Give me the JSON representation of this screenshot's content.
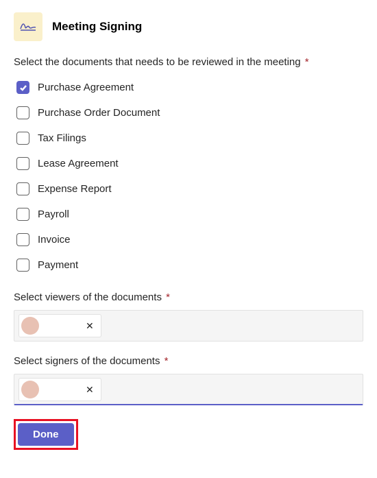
{
  "header": {
    "title": "Meeting Signing"
  },
  "fields": {
    "documents": {
      "label": "Select the documents that needs to be reviewed in the meeting",
      "required_marker": "*",
      "items": [
        {
          "label": "Purchase Agreement",
          "checked": true
        },
        {
          "label": "Purchase Order Document",
          "checked": false
        },
        {
          "label": "Tax Filings",
          "checked": false
        },
        {
          "label": "Lease Agreement",
          "checked": false
        },
        {
          "label": "Expense Report",
          "checked": false
        },
        {
          "label": "Payroll",
          "checked": false
        },
        {
          "label": "Invoice",
          "checked": false
        },
        {
          "label": "Payment",
          "checked": false
        }
      ]
    },
    "viewers": {
      "label": "Select viewers of the documents",
      "required_marker": "*",
      "chip": {
        "label": ""
      }
    },
    "signers": {
      "label": "Select signers of the documents",
      "required_marker": "*",
      "chip": {
        "label": ""
      }
    }
  },
  "actions": {
    "done_label": "Done"
  },
  "icons": {
    "remove": "✕"
  }
}
